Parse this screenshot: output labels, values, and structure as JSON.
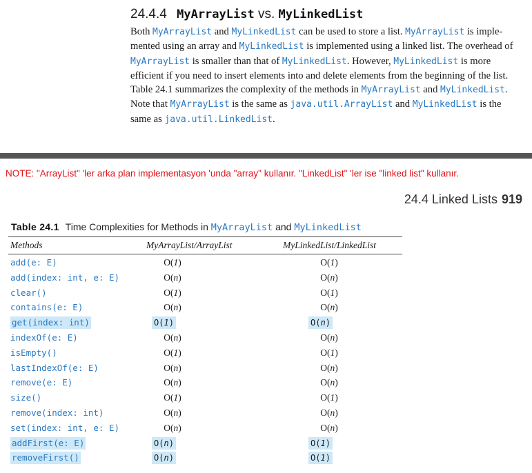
{
  "section": {
    "number": "24.4.4",
    "title_a": "MyArrayList",
    "title_vs": "vs.",
    "title_b": "MyLinkedList",
    "paragraph": [
      {
        "t": "Both ",
        "c": false
      },
      {
        "t": "MyArrayList",
        "c": true
      },
      {
        "t": " and ",
        "c": false
      },
      {
        "t": "MyLinkedList",
        "c": true
      },
      {
        "t": " can be used to store a list. ",
        "c": false
      },
      {
        "t": "MyArrayList",
        "c": true
      },
      {
        "t": " is imple-mented using an array and ",
        "c": false
      },
      {
        "t": "MyLinkedList",
        "c": true
      },
      {
        "t": " is implemented using a linked list. The overhead of ",
        "c": false
      },
      {
        "t": "MyArrayList",
        "c": true
      },
      {
        "t": " is smaller than that of ",
        "c": false
      },
      {
        "t": "MyLinkedList",
        "c": true
      },
      {
        "t": ". However, ",
        "c": false
      },
      {
        "t": "MyLinkedList",
        "c": true
      },
      {
        "t": " is more efficient if you need to insert elements into and delete elements from the beginning of the list. Table 24.1 summarizes the complexity of the methods in ",
        "c": false
      },
      {
        "t": "MyArrayList",
        "c": true
      },
      {
        "t": " and ",
        "c": false
      },
      {
        "t": "MyLinkedList",
        "c": true
      },
      {
        "t": ". Note that ",
        "c": false
      },
      {
        "t": "MyArrayList",
        "c": true
      },
      {
        "t": " is the same as ",
        "c": false
      },
      {
        "t": "java.util.ArrayList",
        "c": true
      },
      {
        "t": " and ",
        "c": false
      },
      {
        "t": "MyLinkedList",
        "c": true
      },
      {
        "t": " is the same as ",
        "c": false
      },
      {
        "t": "java.util.LinkedList",
        "c": true
      },
      {
        "t": ".",
        "c": false
      }
    ]
  },
  "note": "NOTE:  \"ArrayList\" 'ler arka plan implementasyon 'unda \"array\" kullanır. \"LinkedList\" 'ler ise \"linked list\" kullanır.",
  "running_header": {
    "text": "24.4  Linked Lists",
    "page": "919"
  },
  "table": {
    "label": "Table 24.1",
    "title_prefix": "Time Complexities for Methods in ",
    "title_a": "MyArrayList",
    "title_and": " and ",
    "title_b": "MyLinkedList",
    "headers": [
      "Methods",
      "MyArrayList/ArrayList",
      "MyLinkedList/LinkedList"
    ],
    "rows": [
      {
        "method": "add(e: E)",
        "array": "O(1)",
        "linked": "O(1)",
        "highlight": false
      },
      {
        "method": "add(index: int, e: E)",
        "array": "O(n)",
        "linked": "O(n)",
        "highlight": false
      },
      {
        "method": "clear()",
        "array": "O(1)",
        "linked": "O(1)",
        "highlight": false
      },
      {
        "method": "contains(e: E)",
        "array": "O(n)",
        "linked": "O(n)",
        "highlight": false
      },
      {
        "method": "get(index: int)",
        "array": "O(1)",
        "linked": "O(n)",
        "highlight": true
      },
      {
        "method": "indexOf(e: E)",
        "array": "O(n)",
        "linked": "O(n)",
        "highlight": false
      },
      {
        "method": "isEmpty()",
        "array": "O(1)",
        "linked": "O(1)",
        "highlight": false
      },
      {
        "method": "lastIndexOf(e: E)",
        "array": "O(n)",
        "linked": "O(n)",
        "highlight": false
      },
      {
        "method": "remove(e: E)",
        "array": "O(n)",
        "linked": "O(n)",
        "highlight": false
      },
      {
        "method": "size()",
        "array": "O(1)",
        "linked": "O(1)",
        "highlight": false
      },
      {
        "method": "remove(index: int)",
        "array": "O(n)",
        "linked": "O(n)",
        "highlight": false
      },
      {
        "method": "set(index: int, e: E)",
        "array": "O(n)",
        "linked": "O(n)",
        "highlight": false
      },
      {
        "method": "addFirst(e: E)",
        "array": "O(n)",
        "linked": "O(1)",
        "highlight": true
      },
      {
        "method": "removeFirst()",
        "array": "O(n)",
        "linked": "O(1)",
        "highlight": true
      }
    ]
  },
  "colors": {
    "code": "#2a79c2",
    "note": "#e0121a",
    "highlight": "#cde8f8",
    "divider": "#555555"
  }
}
